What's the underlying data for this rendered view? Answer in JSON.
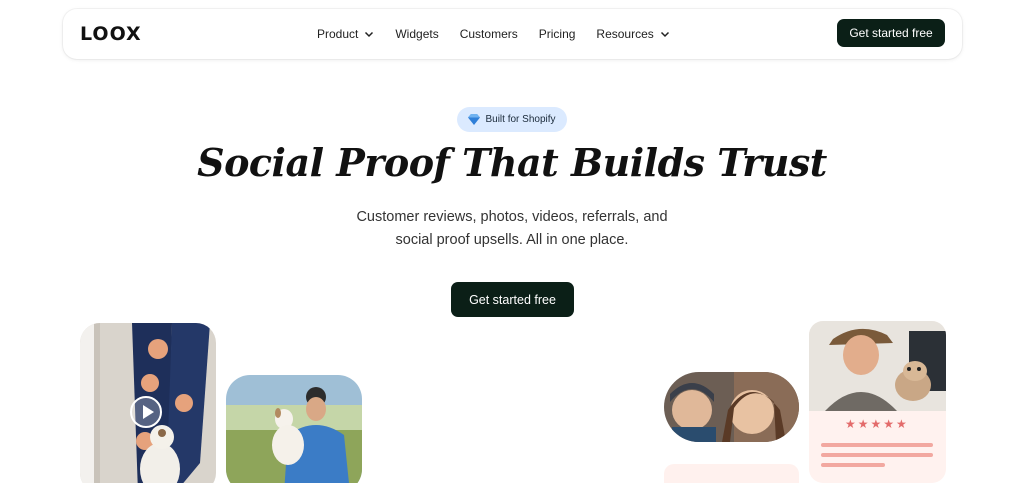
{
  "nav": {
    "logo": "LOOX",
    "items": [
      {
        "label": "Product",
        "dropdown": true
      },
      {
        "label": "Widgets",
        "dropdown": false
      },
      {
        "label": "Customers",
        "dropdown": false
      },
      {
        "label": "Pricing",
        "dropdown": false
      },
      {
        "label": "Resources",
        "dropdown": true
      }
    ],
    "cta": "Get started free"
  },
  "hero": {
    "badge": "Built for Shopify",
    "title": "Social Proof That Builds Trust",
    "subtitle_line1": "Customer reviews, photos, videos, referrals, and",
    "subtitle_line2": "social proof upsells. All in one place.",
    "cta": "Get started free"
  },
  "review_card": {
    "rating": 5,
    "stars_text": "★★★★★"
  },
  "colors": {
    "cta_bg": "#0b1f17",
    "badge_bg": "#dbeaff",
    "star": "#e36b6b",
    "review_bar": "#f2a8a0"
  },
  "icons": [
    "chevron-down-icon",
    "diamond-icon",
    "play-icon",
    "star-icon"
  ]
}
